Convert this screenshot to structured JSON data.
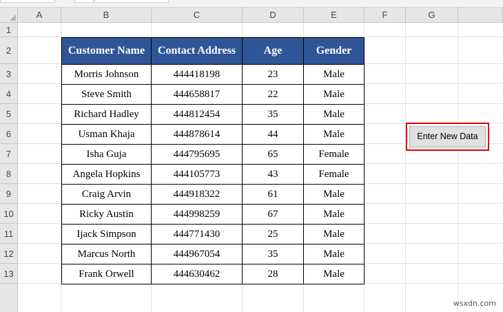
{
  "columns": [
    "A",
    "B",
    "C",
    "D",
    "E",
    "F",
    "G"
  ],
  "rows": [
    "1",
    "2",
    "3",
    "4",
    "5",
    "6",
    "7",
    "8",
    "9",
    "10",
    "11",
    "12",
    "13"
  ],
  "table": {
    "headers": [
      "Customer Name",
      "Contact Address",
      "Age",
      "Gender"
    ],
    "records": [
      [
        "Morris Johnson",
        "444418198",
        "23",
        "Male"
      ],
      [
        "Steve Smith",
        "444658817",
        "22",
        "Male"
      ],
      [
        "Richard Hadley",
        "444812454",
        "35",
        "Male"
      ],
      [
        "Usman Khaja",
        "444878614",
        "44",
        "Male"
      ],
      [
        "Isha Guja",
        "444795695",
        "65",
        "Female"
      ],
      [
        "Angela Hopkins",
        "444105773",
        "43",
        "Female"
      ],
      [
        "Craig Arvin",
        "444918322",
        "61",
        "Male"
      ],
      [
        "Ricky Austin",
        "444998259",
        "67",
        "Male"
      ],
      [
        "Ijack Simpson",
        "444771430",
        "25",
        "Male"
      ],
      [
        "Marcus North",
        "444967054",
        "35",
        "Male"
      ],
      [
        "Frank Orwell",
        "444630462",
        "28",
        "Male"
      ]
    ]
  },
  "button": {
    "label": "Enter New Data"
  },
  "watermark": "wsxdn.com",
  "colors": {
    "header_fill": "#2f5597",
    "highlight_border": "#e00000"
  }
}
